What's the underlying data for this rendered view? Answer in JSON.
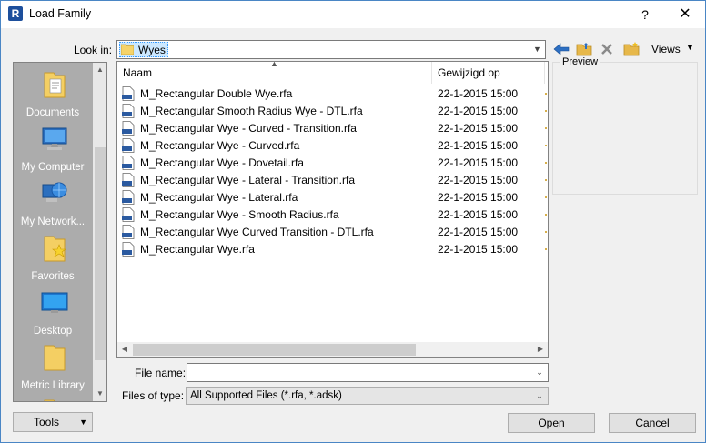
{
  "window": {
    "title": "Load Family",
    "help_label": "?",
    "close_label": "✕"
  },
  "lookin": {
    "label": "Look in:",
    "value": "Wyes"
  },
  "toolbar": {
    "views_label": "Views"
  },
  "places": [
    {
      "label": "Documents",
      "icon": "documents-folder-icon"
    },
    {
      "label": "My Computer",
      "icon": "computer-icon"
    },
    {
      "label": "My Network...",
      "icon": "network-globe-icon"
    },
    {
      "label": "Favorites",
      "icon": "favorites-folder-icon"
    },
    {
      "label": "Desktop",
      "icon": "desktop-icon"
    },
    {
      "label": "Metric Library",
      "icon": "folder-icon"
    }
  ],
  "filelist": {
    "columns": {
      "name": "Naam",
      "date": "Gewijzigd op"
    },
    "files": [
      {
        "name": "M_Rectangular Double Wye.rfa",
        "date": "22-1-2015 15:00"
      },
      {
        "name": "M_Rectangular Smooth Radius Wye - DTL.rfa",
        "date": "22-1-2015 15:00"
      },
      {
        "name": "M_Rectangular Wye - Curved - Transition.rfa",
        "date": "22-1-2015 15:00"
      },
      {
        "name": "M_Rectangular Wye - Curved.rfa",
        "date": "22-1-2015 15:00"
      },
      {
        "name": "M_Rectangular Wye - Dovetail.rfa",
        "date": "22-1-2015 15:00"
      },
      {
        "name": "M_Rectangular Wye - Lateral - Transition.rfa",
        "date": "22-1-2015 15:00"
      },
      {
        "name": "M_Rectangular Wye - Lateral.rfa",
        "date": "22-1-2015 15:00"
      },
      {
        "name": "M_Rectangular Wye - Smooth Radius.rfa",
        "date": "22-1-2015 15:00"
      },
      {
        "name": "M_Rectangular Wye Curved Transition - DTL.rfa",
        "date": "22-1-2015 15:00"
      },
      {
        "name": "M_Rectangular Wye.rfa",
        "date": "22-1-2015 15:00"
      }
    ]
  },
  "preview": {
    "label": "Preview"
  },
  "form": {
    "filename_label": "File name:",
    "filename_value": "",
    "filetype_label": "Files of type:",
    "filetype_value": "All Supported Files  (*.rfa, *.adsk)"
  },
  "buttons": {
    "tools": "Tools",
    "open": "Open",
    "cancel": "Cancel"
  },
  "colors": {
    "accent": "#1d4f9c",
    "selection": "#cce8ff",
    "places_bg": "#acacac"
  }
}
